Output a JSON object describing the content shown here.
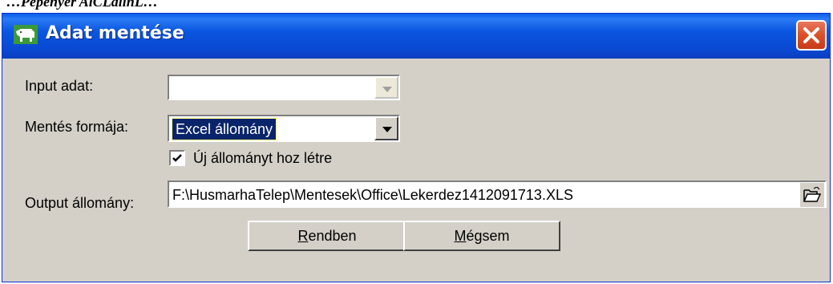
{
  "background": {
    "caption": "…Pepenyer AlCLallnL…"
  },
  "window": {
    "title": "Adat mentése",
    "close_symbol": "✕",
    "title_bar_color": "#0a56e0",
    "body_color": "#d4d0c8"
  },
  "form": {
    "input_label": "Input adat:",
    "input_value": "",
    "format_label": "Mentés formája:",
    "format_value": "Excel állomány",
    "new_file_checkbox": {
      "label": "Új állományt hoz létre",
      "checked": true
    },
    "output_label": "Output állomány:",
    "output_value": "F:\\HusmarhaTelep\\Mentesek\\Office\\Lekerdez1412091713.XLS"
  },
  "buttons": {
    "ok_mnemonic": "R",
    "ok_rest": "endben",
    "cancel_mnemonic": "M",
    "cancel_rest": "égsem"
  },
  "icons": {
    "app": "cow-icon",
    "close": "close-icon",
    "dropdown": "chevron-down-icon",
    "browse": "open-folder-icon",
    "check": "check-icon"
  }
}
